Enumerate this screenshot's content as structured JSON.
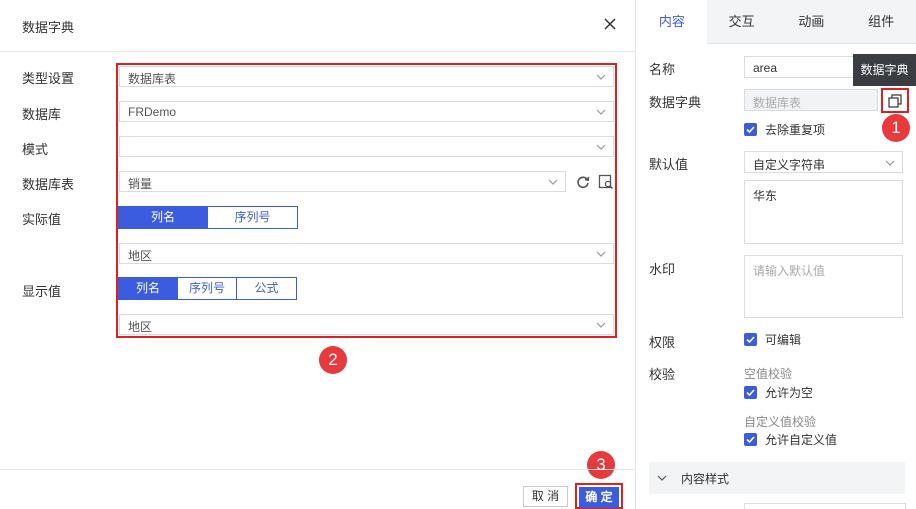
{
  "dialog": {
    "title": "数据字典",
    "close_icon": "close-icon",
    "labels": {
      "type": "类型设置",
      "database": "数据库",
      "schema": "模式",
      "table": "数据库表",
      "actual": "实际值",
      "display": "显示值"
    },
    "fields": {
      "type_value": "数据库表",
      "database_value": "FRDemo",
      "schema_value": "",
      "table_value": "销量",
      "actual_column": "地区",
      "display_column": "地区"
    },
    "actual_toggle": {
      "column": "列名",
      "index": "序列号",
      "selected": "列名"
    },
    "display_toggle": {
      "column": "列名",
      "index": "序列号",
      "formula": "公式",
      "selected": "列名"
    },
    "icons": {
      "refresh": "refresh-icon",
      "preview": "preview-icon",
      "chevron": "chevron-down-icon"
    },
    "footer": {
      "cancel": "取 消",
      "ok": "确 定"
    }
  },
  "badges": {
    "one": "1",
    "two": "2",
    "three": "3"
  },
  "panel": {
    "tabs": [
      {
        "label": "内容",
        "active": true
      },
      {
        "label": "交互",
        "active": false
      },
      {
        "label": "动画",
        "active": false
      },
      {
        "label": "组件",
        "active": false
      }
    ],
    "labels": {
      "name": "名称",
      "dict": "数据字典",
      "default": "默认值",
      "watermark": "水印",
      "permission": "权限",
      "validation": "校验"
    },
    "name_value": "area",
    "dict_value": "数据库表",
    "remove_duplicates": "去除重复项",
    "default_type": "自定义字符串",
    "default_value": "华东",
    "watermark_placeholder": "请输入默认值",
    "editable": "可编辑",
    "empty_check_title": "空值校验",
    "allow_empty": "允许为空",
    "custom_check_title": "自定义值校验",
    "allow_custom": "允许自定义值",
    "section_title": "内容样式",
    "tooltip": "数据字典",
    "copy_icon": "copy-icon"
  },
  "colors": {
    "accent": "#3c5ce0",
    "highlight": "#e02020",
    "badge": "#e8393c"
  }
}
